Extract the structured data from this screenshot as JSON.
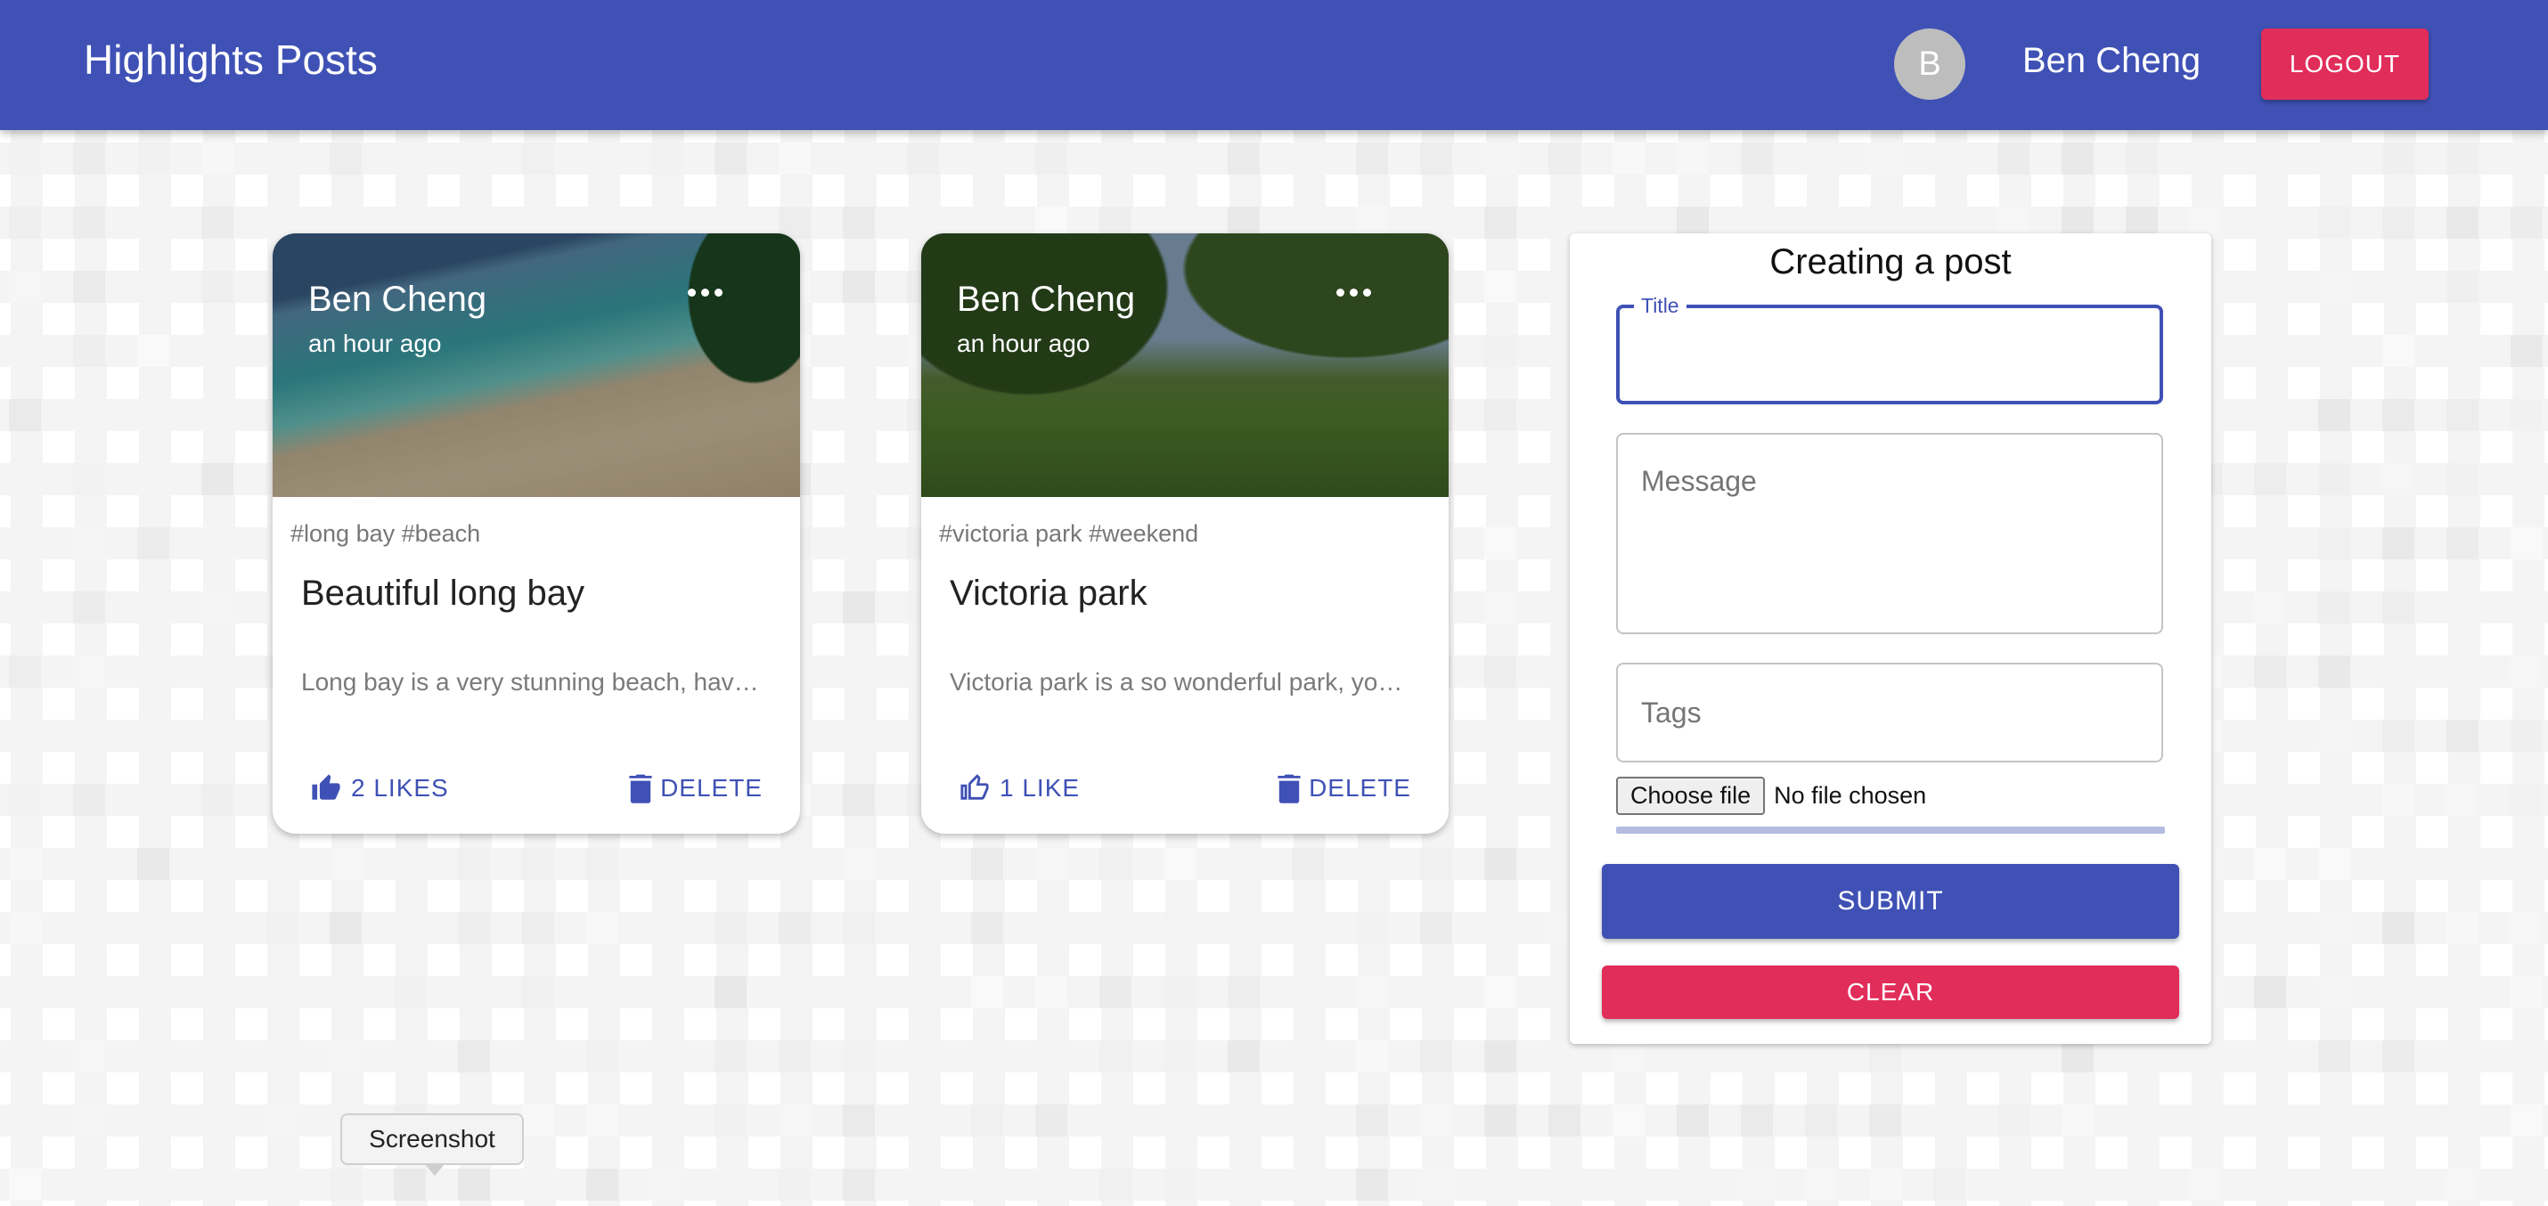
{
  "appbar": {
    "title": "Highlights Posts",
    "avatar_initial": "B",
    "user_name": "Ben Cheng",
    "logout_label": "LOGOUT"
  },
  "posts": [
    {
      "author": "Ben Cheng",
      "time": "an hour ago",
      "tags": "#long bay #beach",
      "title": "Beautiful long bay",
      "message": "Long bay is a very stunning beach, hav…",
      "like_label": "2 LIKES",
      "delete_label": "DELETE"
    },
    {
      "author": "Ben Cheng",
      "time": "an hour ago",
      "tags": "#victoria park #weekend",
      "title": "Victoria park",
      "message": "Victoria park is a so wonderful park, yo…",
      "like_label": "1 LIKE",
      "delete_label": "DELETE"
    }
  ],
  "form": {
    "heading": "Creating a post",
    "title_label": "Title",
    "title_value": "",
    "message_placeholder": "Message",
    "tags_placeholder": "Tags",
    "file_button_label": "Choose file",
    "file_status": "No file chosen",
    "submit_label": "SUBMIT",
    "clear_label": "CLEAR"
  },
  "tooltip": {
    "text": "Screenshot"
  },
  "colors": {
    "primary": "#3f51b5",
    "secondary": "#e12d5a"
  }
}
